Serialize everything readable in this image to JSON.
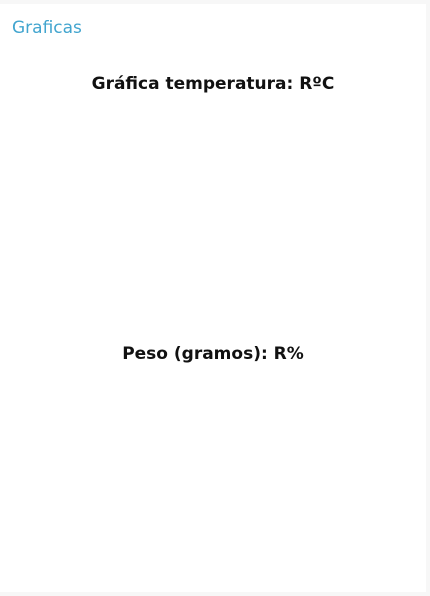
{
  "header": {
    "title": "Graficas",
    "accent_color": "#42a5cf"
  },
  "charts": {
    "temperature": {
      "title": "Gráfica temperatura: RºC"
    },
    "weight": {
      "title": "Peso (gramos): R%"
    }
  }
}
